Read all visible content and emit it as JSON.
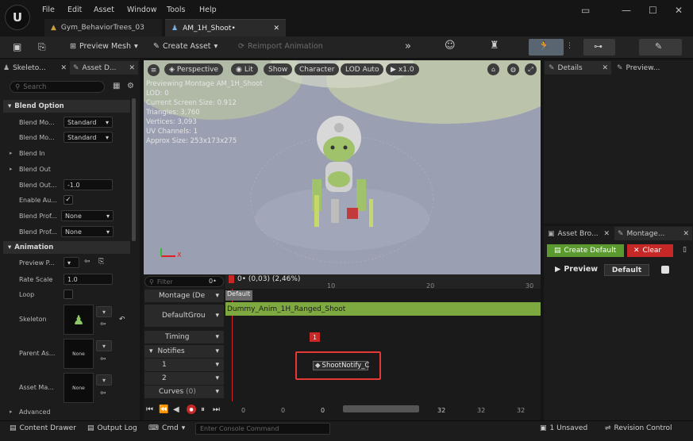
{
  "menu": [
    "File",
    "Edit",
    "Asset",
    "Window",
    "Tools",
    "Help"
  ],
  "tabs": [
    {
      "label": "Gym_BehaviorTrees_03"
    },
    {
      "label": "AM_1H_Shoot•"
    }
  ],
  "toolbar": {
    "preview_mesh": "Preview Mesh",
    "create_asset": "Create Asset",
    "reimport": "Reimport Animation"
  },
  "left_panel": {
    "tab_skeleton": "Skeleto...",
    "tab_asset_details": "Asset D...",
    "search_placeholder": "Search",
    "blend_option_header": "Blend Option",
    "blend_mode_in_label": "Blend Mo...",
    "blend_mode_in_value": "Standard",
    "blend_mode_out_label": "Blend Mo...",
    "blend_mode_out_value": "Standard",
    "blend_in": "Blend In",
    "blend_out": "Blend Out",
    "blend_out_trigger_label": "Blend Out...",
    "blend_out_trigger_value": "-1.0",
    "enable_auto_label": "Enable Au...",
    "blend_profile_in_label": "Blend Prof...",
    "blend_profile_in_value": "None",
    "blend_profile_out_label": "Blend Prof...",
    "blend_profile_out_value": "None",
    "animation_header": "Animation",
    "preview_pose_label": "Preview P...",
    "rate_scale_label": "Rate Scale",
    "rate_scale_value": "1.0",
    "loop_label": "Loop",
    "skeleton_label": "Skeleton",
    "parent_asset_label": "Parent As...",
    "parent_asset_thumb": "None",
    "asset_mapping_label": "Asset Ma...",
    "asset_mapping_thumb": "None",
    "advanced_label": "Advanced"
  },
  "viewport": {
    "perspective": "Perspective",
    "lit": "Lit",
    "show": "Show",
    "character": "Character",
    "lod_auto": "LOD Auto",
    "speed": "x1.0",
    "info": [
      "Previewing Montage AM_1H_Shoot",
      "LOD: 0",
      "Current Screen Size: 0.912",
      "Triangles: 3,760",
      "Vertices: 3,093",
      "UV Channels: 1",
      "Approx Size: 253x173x275"
    ],
    "axis_x": "X"
  },
  "timeline": {
    "filter_placeholder": "Filter",
    "zero": "0•",
    "playhead": "0• (0,03) (2,46%)",
    "ticks": [
      "10",
      "20",
      "30"
    ],
    "tracks": {
      "montage": "Montage (De",
      "default_group": "DefaultGrou",
      "timing": "Timing",
      "notifies": "Notifies",
      "notify1": "1",
      "notify2": "2",
      "curves": "Curves",
      "curves_count": "(0)"
    },
    "section_default": "Default",
    "slot_anim": "Dummy_Anim_1H_Ranged_Shoot",
    "timing_marker": "1",
    "notify_name": "ShootNotify_C",
    "transport_values": [
      "0",
      "0",
      "0",
      "32",
      "32",
      "32"
    ]
  },
  "right_top": {
    "tab_details": "Details",
    "tab_preview": "Preview..."
  },
  "right_bottom": {
    "tab_asset_browser": "Asset Bro...",
    "tab_montage": "Montage...",
    "create_default": "Create Default",
    "clear": "Clear",
    "preview": "Preview",
    "default": "Default"
  },
  "status": {
    "content_drawer": "Content Drawer",
    "output_log": "Output Log",
    "cmd": "Cmd",
    "console_placeholder": "Enter Console Command",
    "unsaved": "1 Unsaved",
    "revision_control": "Revision Control"
  },
  "colors": {
    "accent_green": "#5a9a2e",
    "clear_red": "#c62828",
    "highlight_red": "#e53935",
    "slot_bar": "#7ea840"
  }
}
